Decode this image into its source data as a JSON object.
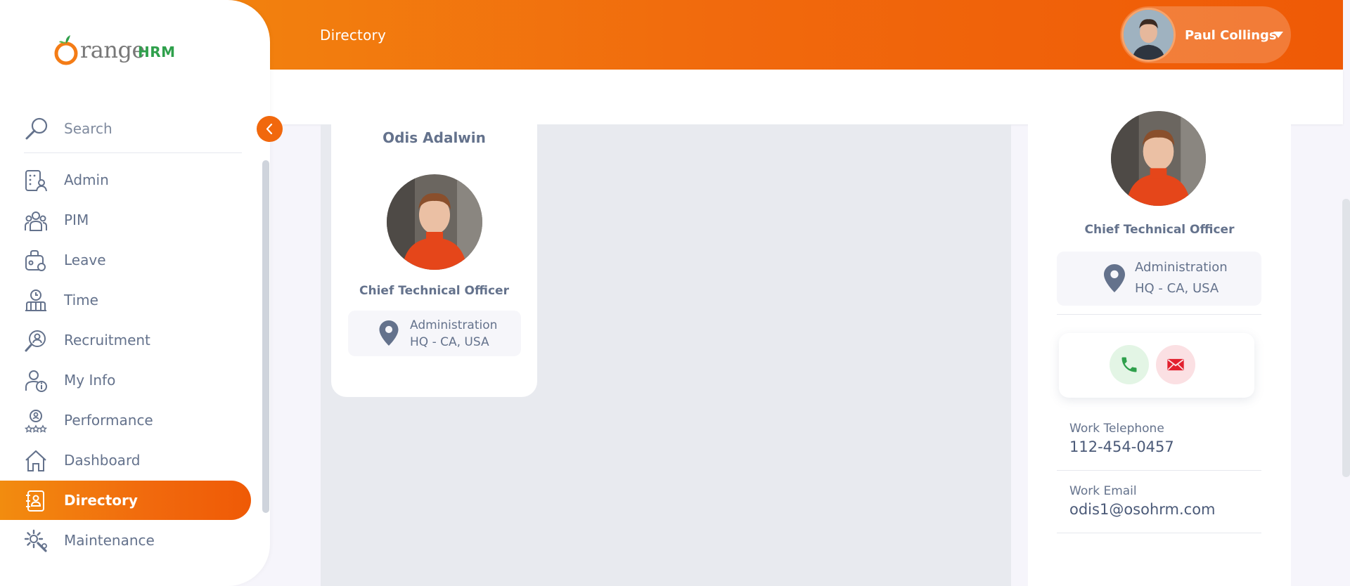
{
  "header": {
    "title": "Directory",
    "user_name": "Paul Collings"
  },
  "sidebar": {
    "brand_main": "range",
    "brand_suffix": "HRM",
    "search_label": "Search",
    "items": [
      {
        "label": "Admin",
        "icon": "admin-icon"
      },
      {
        "label": "PIM",
        "icon": "pim-icon"
      },
      {
        "label": "Leave",
        "icon": "leave-icon"
      },
      {
        "label": "Time",
        "icon": "time-icon"
      },
      {
        "label": "Recruitment",
        "icon": "recruitment-icon"
      },
      {
        "label": "My Info",
        "icon": "my-info-icon"
      },
      {
        "label": "Performance",
        "icon": "performance-icon"
      },
      {
        "label": "Dashboard",
        "icon": "dashboard-icon"
      },
      {
        "label": "Directory",
        "icon": "directory-icon",
        "active": true
      },
      {
        "label": "Maintenance",
        "icon": "maintenance-icon"
      }
    ]
  },
  "employee_card": {
    "name": "Odis Adalwin",
    "job_title": "Chief Technical Officer",
    "subunit": "Administration",
    "location": "HQ - CA, USA"
  },
  "detail_panel": {
    "job_title": "Chief Technical Officer",
    "subunit": "Administration",
    "location": "HQ - CA, USA",
    "work_telephone_label": "Work Telephone",
    "work_telephone": "112-454-0457",
    "work_email_label": "Work Email",
    "work_email": "odis1@osohrm.com"
  },
  "colors": {
    "accent": "#f1690d",
    "text": "#64728c",
    "phone": "#2fa04c",
    "mail": "#e2202e"
  }
}
